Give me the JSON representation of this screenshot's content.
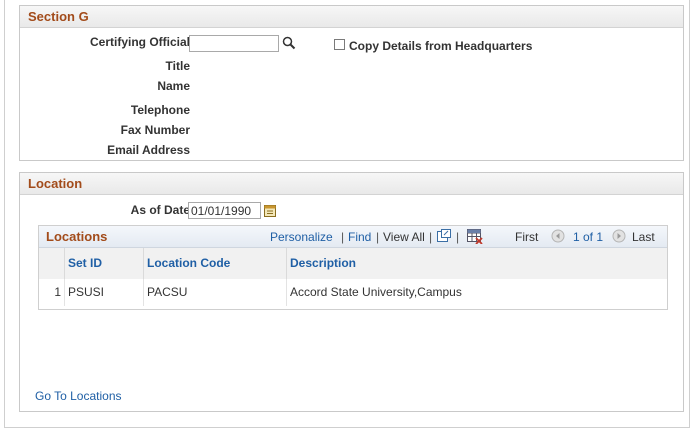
{
  "section_g": {
    "title": "Section G",
    "certifying_official_label": "Certifying Official",
    "certifying_official_value": "",
    "copy_details_label": "Copy Details from Headquarters",
    "copy_details_checked": false,
    "title_label": "Title",
    "name_label": "Name",
    "telephone_label": "Telephone",
    "fax_label": "Fax Number",
    "email_label": "Email Address"
  },
  "location": {
    "title": "Location",
    "as_of_date_label": "As of Date",
    "as_of_date_value": "01/01/1990",
    "grid": {
      "title": "Locations",
      "personalize": "Personalize",
      "find": "Find",
      "view_all": "View All",
      "first": "First",
      "pagination": "1 of 1",
      "last": "Last",
      "separator": "|",
      "columns": [
        "Set ID",
        "Location Code",
        "Description"
      ],
      "rows": [
        {
          "num": "1",
          "set_id": "PSUSI",
          "location_code": "PACSU",
          "description": "Accord State University,Campus"
        }
      ]
    },
    "go_to_locations": "Go To Locations"
  },
  "colors": {
    "section_title": "#a24b1a",
    "link": "#1f5fa5"
  },
  "icons": [
    "search-icon",
    "calendar-icon",
    "zoom-grid-icon",
    "download-grid-icon",
    "prev-icon",
    "next-icon"
  ]
}
